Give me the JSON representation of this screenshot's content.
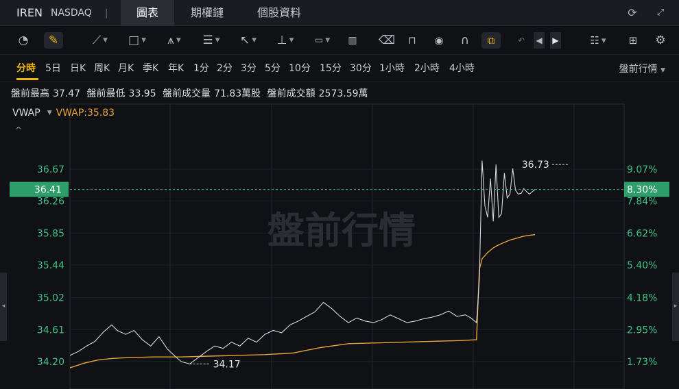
{
  "header": {
    "ticker": "IREN",
    "exchange": "NASDAQ",
    "separator": "|",
    "tabs": [
      {
        "label": "圖表",
        "active": true
      },
      {
        "label": "期權鏈",
        "active": false
      },
      {
        "label": "個股資料",
        "active": false
      }
    ]
  },
  "toolbar": {
    "tools": [
      "gauge-icon",
      "draw-pen-icon",
      "trend-line-icon",
      "rectangle-icon",
      "pattern-icon",
      "fib-icon",
      "arrow-icon",
      "vertical-measure-icon",
      "text-label-icon",
      "indicator-bars-icon",
      "eraser-icon",
      "unlock-icon",
      "eye-icon",
      "magnet-icon",
      "link-icon",
      "undo-icon",
      "prev-icon",
      "next-icon",
      "layout-icon",
      "grid-icon",
      "settings-icon"
    ]
  },
  "periods": {
    "items": [
      "分時",
      "5日",
      "日K",
      "周K",
      "月K",
      "季K",
      "年K",
      "1分",
      "2分",
      "3分",
      "5分",
      "10分",
      "15分",
      "30分",
      "1小時",
      "2小時",
      "4小時"
    ],
    "active": "分時",
    "session": "盤前行情"
  },
  "stats": {
    "high_label": "盤前最高",
    "high": "37.47",
    "low_label": "盤前最低",
    "low": "33.95",
    "volume_label": "盤前成交量",
    "volume": "71.83萬股",
    "turnover_label": "盤前成交額",
    "turnover": "2573.59萬"
  },
  "indicator": {
    "name": "VWAP",
    "value_text": "VWAP:35.83",
    "collapse": "^"
  },
  "colors": {
    "price_line": "#d7d9dc",
    "vwap_line": "#e8a33d",
    "axis_up": "#3fbf86",
    "current_tag_bg": "#2e9e6b",
    "accent": "#f0b90b"
  },
  "chart_data": {
    "type": "line",
    "watermark": "盤前行情",
    "y_ticks": [
      "36.67",
      "36.26",
      "35.85",
      "35.44",
      "35.02",
      "34.61",
      "34.20"
    ],
    "pct_ticks": [
      "9.07%",
      "7.84%",
      "6.62%",
      "5.40%",
      "4.18%",
      "2.95%",
      "1.73%"
    ],
    "ylim": [
      34.12,
      37.1
    ],
    "current_price": "36.41",
    "current_pct": "8.30%",
    "current_value": 36.41,
    "high_marker": {
      "label": "36.73",
      "value": 36.73,
      "index": 180
    },
    "low_marker": {
      "label": "34.17",
      "value": 34.17,
      "index": 43
    },
    "x_count": 200,
    "series": [
      {
        "key": "price",
        "x": [
          0,
          3,
          6,
          9,
          12,
          15,
          17,
          20,
          23,
          26,
          29,
          32,
          35,
          38,
          40,
          43,
          46,
          49,
          52,
          55,
          58,
          61,
          64,
          67,
          70,
          73,
          76,
          79,
          82,
          85,
          88,
          91,
          94,
          97,
          100,
          103,
          106,
          109,
          112,
          115,
          118,
          121,
          124,
          127,
          130,
          133,
          136,
          139,
          142,
          144,
          146,
          147,
          148,
          149,
          150,
          151,
          152,
          153,
          154,
          155,
          156,
          157,
          158,
          159,
          160,
          161,
          162,
          163,
          164,
          165,
          166,
          167
        ],
        "values": [
          34.28,
          34.33,
          34.4,
          34.46,
          34.58,
          34.67,
          34.6,
          34.55,
          34.6,
          34.48,
          34.4,
          34.52,
          34.36,
          34.26,
          34.2,
          34.17,
          34.25,
          34.33,
          34.4,
          34.37,
          34.45,
          34.4,
          34.5,
          34.45,
          34.55,
          34.6,
          34.57,
          34.67,
          34.72,
          34.78,
          34.84,
          34.96,
          34.88,
          34.78,
          34.7,
          34.76,
          34.72,
          34.7,
          34.74,
          34.8,
          34.75,
          34.7,
          34.72,
          34.75,
          34.77,
          34.8,
          34.85,
          34.78,
          34.8,
          34.76,
          34.7,
          35.25,
          36.78,
          36.2,
          36.05,
          36.55,
          36.0,
          36.73,
          36.05,
          36.1,
          36.62,
          36.3,
          36.35,
          36.68,
          36.4,
          36.35,
          36.36,
          36.42,
          36.38,
          36.35,
          36.38,
          36.41
        ]
      },
      {
        "key": "vwap",
        "x": [
          0,
          5,
          10,
          15,
          20,
          30,
          40,
          50,
          60,
          70,
          80,
          90,
          100,
          110,
          120,
          130,
          140,
          146,
          147,
          148,
          150,
          152,
          154,
          156,
          158,
          160,
          163,
          167
        ],
        "values": [
          34.12,
          34.18,
          34.22,
          34.24,
          34.25,
          34.26,
          34.26,
          34.27,
          34.28,
          34.29,
          34.31,
          34.38,
          34.43,
          34.44,
          34.45,
          34.46,
          34.47,
          34.48,
          35.38,
          35.52,
          35.6,
          35.66,
          35.7,
          35.73,
          35.76,
          35.78,
          35.81,
          35.83
        ]
      }
    ]
  }
}
